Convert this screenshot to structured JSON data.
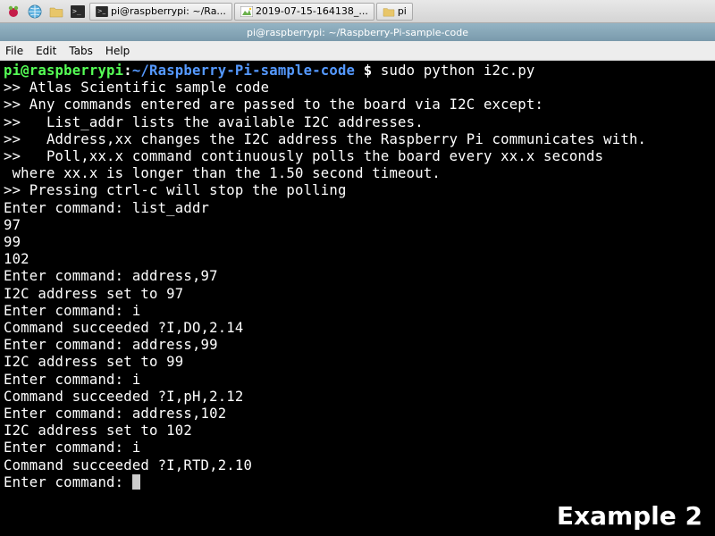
{
  "taskbar": {
    "apps": [
      {
        "name": "raspberry-menu",
        "glyph": "🍓"
      },
      {
        "name": "web-browser",
        "glyph": "🌐"
      },
      {
        "name": "file-manager",
        "glyph": "folder"
      },
      {
        "name": "terminal",
        "glyph": "term"
      }
    ],
    "windows": [
      {
        "icon": "term",
        "label": "pi@raspberrypi: ~/Ra..."
      },
      {
        "icon": "image",
        "label": "2019-07-15-164138_..."
      },
      {
        "icon": "folder",
        "label": "pi"
      }
    ]
  },
  "window": {
    "title": "pi@raspberrypi: ~/Raspberry-Pi-sample-code"
  },
  "menu": {
    "items": [
      "File",
      "Edit",
      "Tabs",
      "Help"
    ]
  },
  "prompt": {
    "user_host": "pi@raspberrypi",
    "colon": ":",
    "path": "~/Raspberry-Pi-sample-code",
    "dollar": " $ ",
    "command": "sudo python i2c.py"
  },
  "output_lines": [
    ">> Atlas Scientific sample code",
    ">> Any commands entered are passed to the board via I2C except:",
    ">>   List_addr lists the available I2C addresses.",
    ">>   Address,xx changes the I2C address the Raspberry Pi communicates with.",
    ">>   Poll,xx.x command continuously polls the board every xx.x seconds",
    " where xx.x is longer than the 1.50 second timeout.",
    ">> Pressing ctrl-c will stop the polling",
    "Enter command: list_addr",
    "97",
    "99",
    "102",
    "Enter command: address,97",
    "I2C address set to 97",
    "Enter command: i",
    "Command succeeded ?I,DO,2.14",
    "Enter command: address,99",
    "I2C address set to 99",
    "Enter command: i",
    "Command succeeded ?I,pH,2.12",
    "Enter command: address,102",
    "I2C address set to 102",
    "Enter command: i",
    "Command succeeded ?I,RTD,2.10",
    "Enter command: "
  ],
  "example_label": "Example 2"
}
